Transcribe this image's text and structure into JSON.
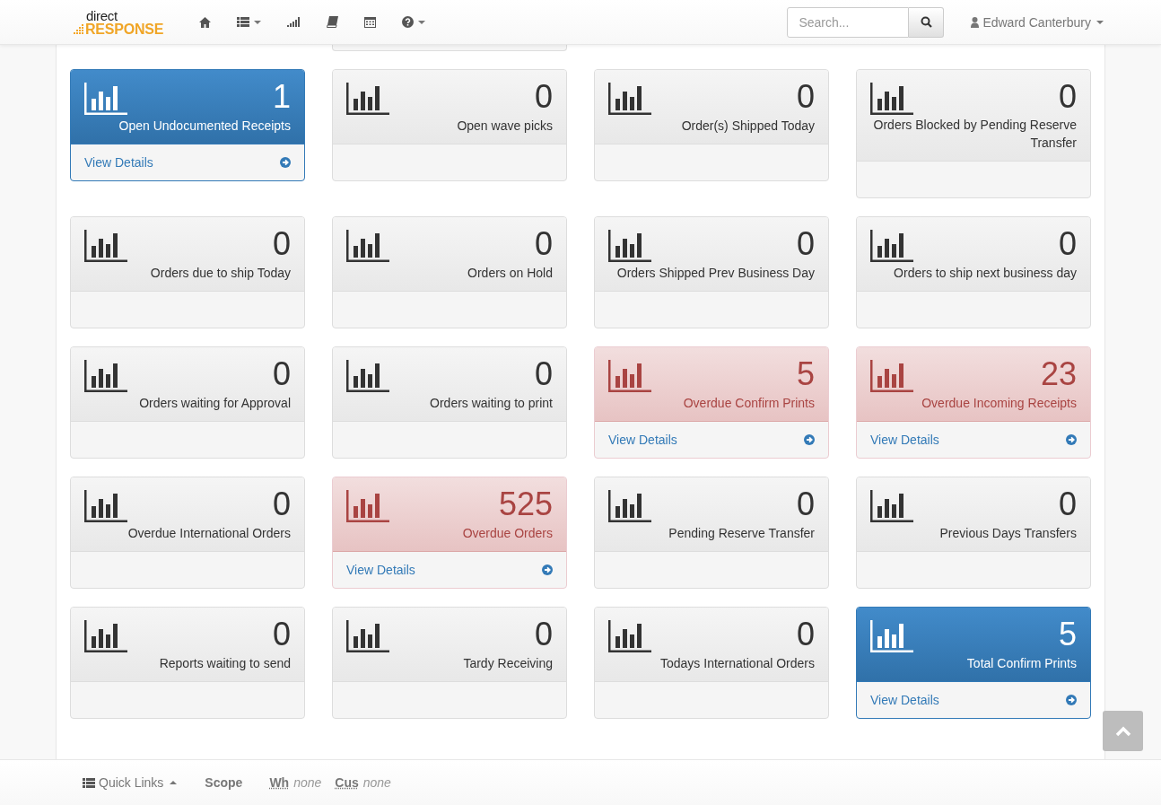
{
  "navbar": {
    "logo": {
      "top": "direct",
      "bottom": "RESPONSE"
    },
    "nav_items": [
      {
        "kind": "home",
        "dropdown": false
      },
      {
        "kind": "list",
        "dropdown": true
      },
      {
        "kind": "signal",
        "dropdown": false
      },
      {
        "kind": "book",
        "dropdown": false
      },
      {
        "kind": "calendar",
        "dropdown": false
      },
      {
        "kind": "help",
        "dropdown": true
      }
    ],
    "search": {
      "placeholder": "Search..."
    },
    "user": "Edward Canterbury"
  },
  "cards": [
    {
      "kind": "primary",
      "count": "1",
      "label": "Open Undocumented Receipts",
      "link": "View Details"
    },
    {
      "kind": "default",
      "count": "0",
      "label": "Open wave picks"
    },
    {
      "kind": "default",
      "count": "0",
      "label": "Order(s) Shipped Today"
    },
    {
      "kind": "default",
      "count": "0",
      "label": "Orders Blocked by Pending Reserve Transfer"
    },
    {
      "kind": "default",
      "count": "0",
      "label": "Orders due to ship Today"
    },
    {
      "kind": "default",
      "count": "0",
      "label": "Orders on Hold"
    },
    {
      "kind": "default",
      "count": "0",
      "label": "Orders Shipped Prev Business Day"
    },
    {
      "kind": "default",
      "count": "0",
      "label": "Orders to ship next business day"
    },
    {
      "kind": "default",
      "count": "0",
      "label": "Orders waiting for Approval"
    },
    {
      "kind": "default",
      "count": "0",
      "label": "Orders waiting to print"
    },
    {
      "kind": "danger",
      "count": "5",
      "label": "Overdue Confirm Prints",
      "link": "View Details"
    },
    {
      "kind": "danger",
      "count": "23",
      "label": "Overdue Incoming Receipts",
      "link": "View Details"
    },
    {
      "kind": "default",
      "count": "0",
      "label": "Overdue International Orders"
    },
    {
      "kind": "danger",
      "count": "525",
      "label": "Overdue Orders",
      "link": "View Details"
    },
    {
      "kind": "default",
      "count": "0",
      "label": "Pending Reserve Transfer"
    },
    {
      "kind": "default",
      "count": "0",
      "label": "Previous Days Transfers"
    },
    {
      "kind": "default",
      "count": "0",
      "label": "Reports waiting to send"
    },
    {
      "kind": "default",
      "count": "0",
      "label": "Tardy Receiving"
    },
    {
      "kind": "default",
      "count": "0",
      "label": "Todays International Orders"
    },
    {
      "kind": "primary",
      "count": "5",
      "label": "Total Confirm Prints",
      "link": "View Details"
    }
  ],
  "footer": {
    "quick_links": "Quick Links",
    "scope": "Scope",
    "filters": [
      {
        "label": "Wh",
        "value": "none"
      },
      {
        "label": "Cus",
        "value": "none"
      }
    ]
  }
}
